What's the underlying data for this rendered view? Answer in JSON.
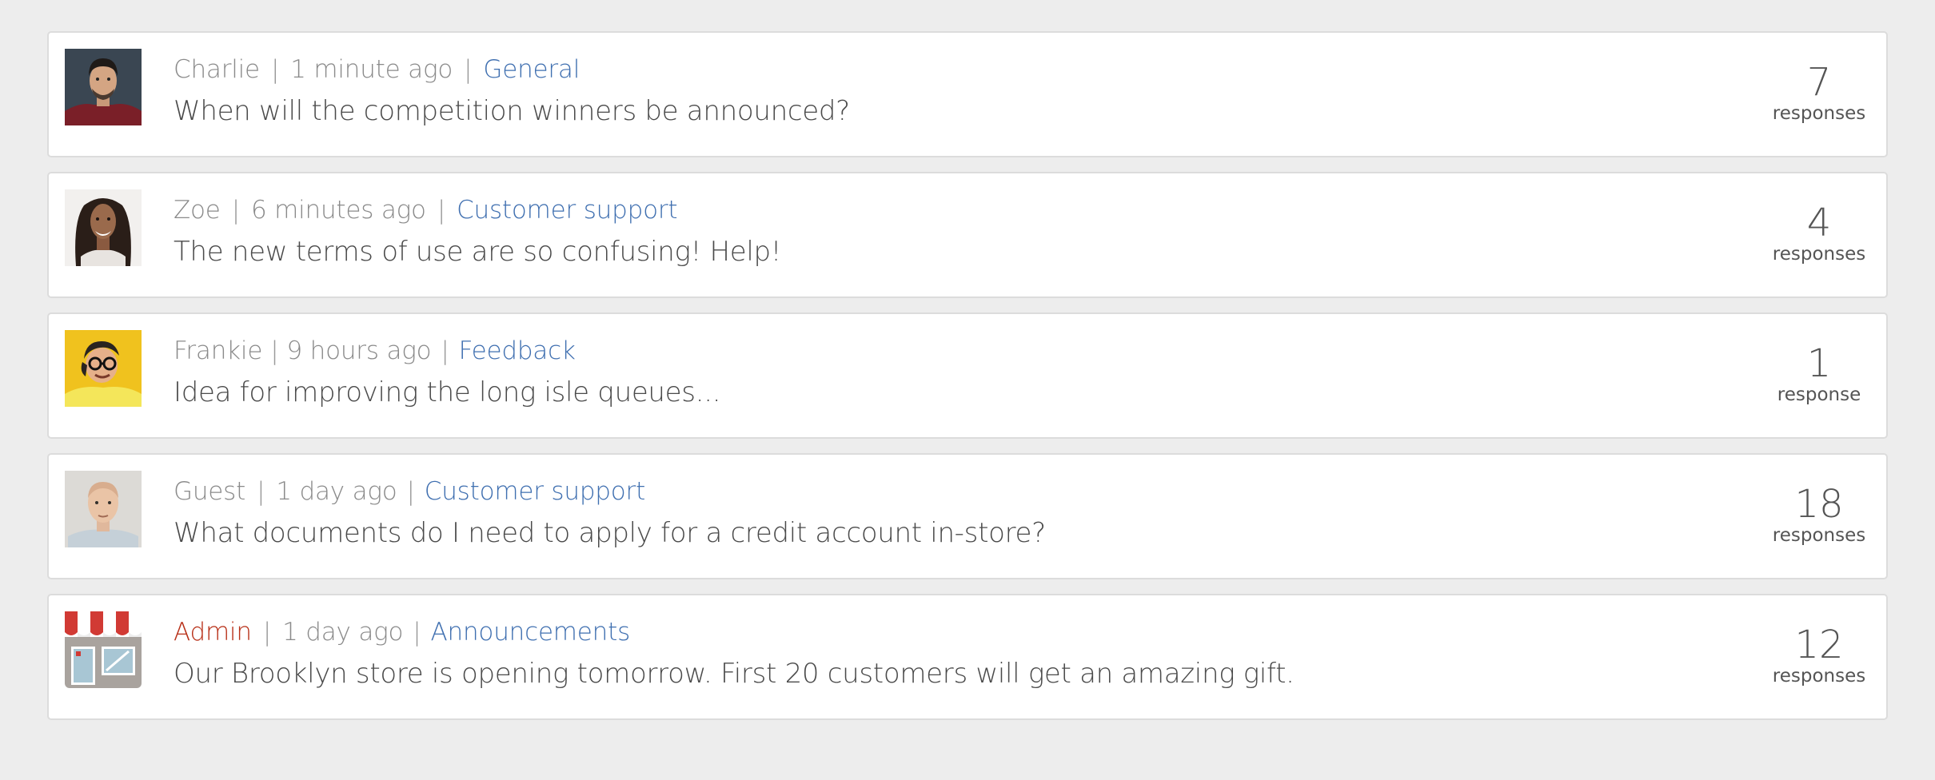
{
  "posts": [
    {
      "avatar_icon": "man-dark-hair-avatar",
      "author": "Charlie",
      "time": "1 minute ago",
      "category": "General",
      "title": "When will the competition winners be announced?",
      "responses": "7",
      "responses_label": "responses"
    },
    {
      "avatar_icon": "woman-smiling-avatar",
      "author": "Zoe",
      "time": "6 minutes ago",
      "category": "Customer support",
      "title": "The new terms of use are so confusing! Help!",
      "responses": "4",
      "responses_label": "responses"
    },
    {
      "avatar_icon": "man-glasses-yellow-avatar",
      "author": "Frankie",
      "time": "9 hours ago",
      "category": "Feedback",
      "title": "Idea for improving the long isle queues...",
      "responses": "1",
      "responses_label": "response"
    },
    {
      "avatar_icon": "bald-man-avatar",
      "author": "Guest",
      "time": "1 day ago",
      "category": "Customer support",
      "title": "What documents do I need to apply for a credit account in-store?",
      "responses": "18",
      "responses_label": "responses"
    },
    {
      "avatar_icon": "storefront-icon",
      "author": "Admin",
      "time": "1 day ago",
      "category": "Announcements",
      "title": "Our Brooklyn store is opening tomorrow. First 20 customers will get an amazing gift.",
      "responses": "12",
      "responses_label": "responses"
    }
  ],
  "colors": {
    "background": "#ededed",
    "card": "#ffffff",
    "category_link": "#3f6fb0",
    "admin_name": "#b83018",
    "meta_text": "#8a8a8a",
    "title_text": "#4a4a4a"
  },
  "separator": "|"
}
